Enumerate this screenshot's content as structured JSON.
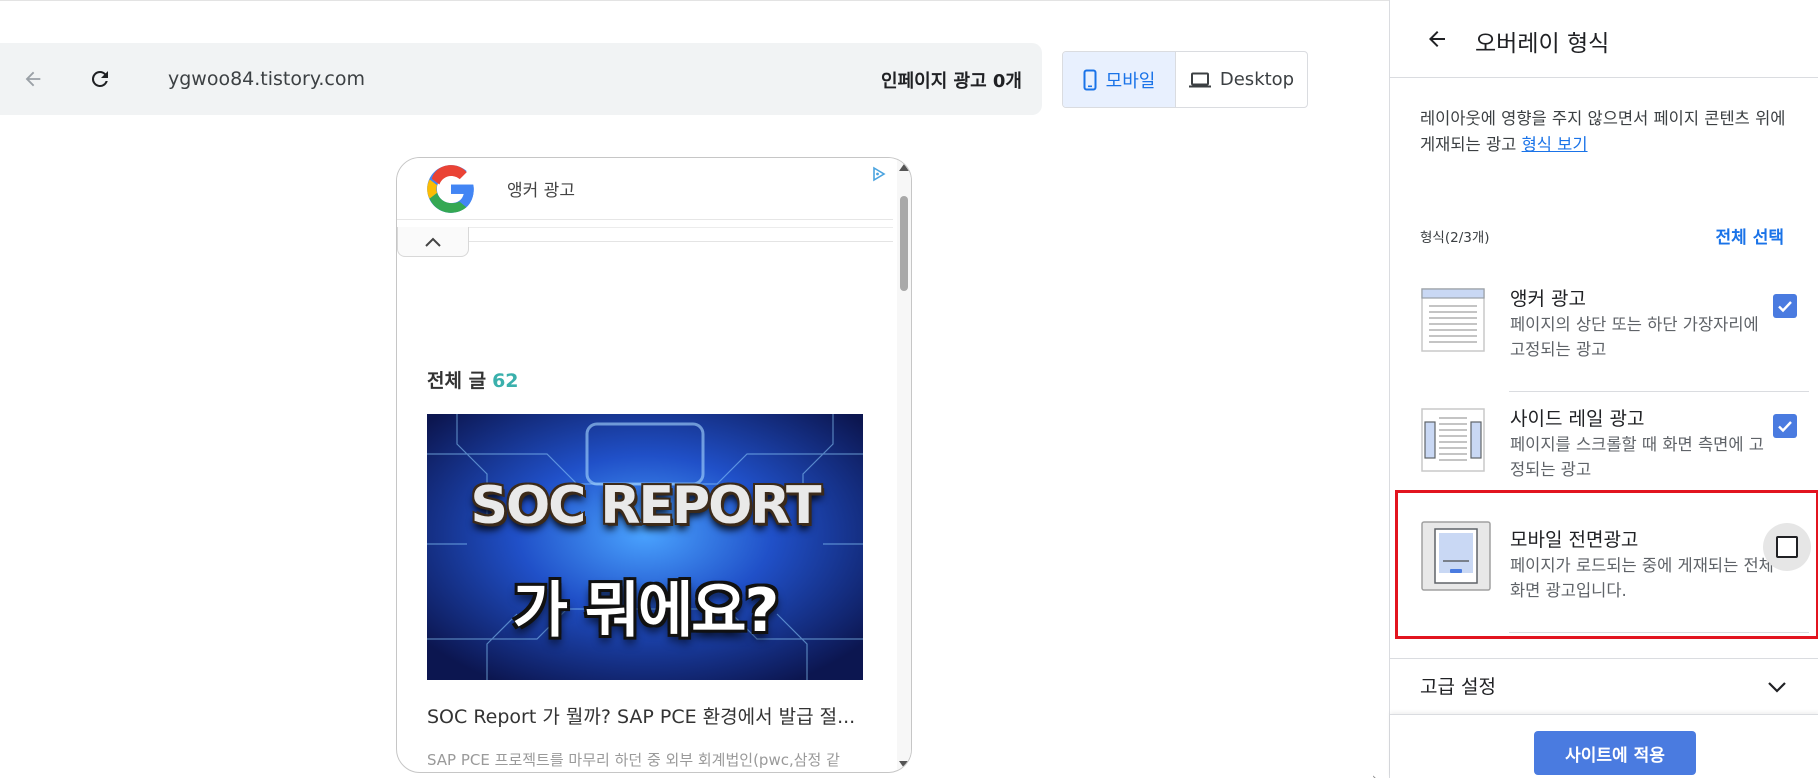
{
  "browser": {
    "url": "ygwoo84.tistory.com",
    "inpage_ads": "인페이지 광고 0개"
  },
  "device_toggle": {
    "mobile_label": "모바일",
    "desktop_label": "Desktop",
    "selected": "mobile"
  },
  "preview": {
    "anchor_ad_label": "앵커 광고",
    "post_heading": "전체 글",
    "post_count": "62",
    "thumbnail_line1": "SOC REPORT",
    "thumbnail_line2": "가 뭐에요?",
    "post_title": "SOC Report 가 뭘까? SAP PCE 환경에서 발급 절...",
    "post_excerpt": "SAP PCE 프로젝트를 마무리 하던 중 외부 회계법인(pwc,삼정 같"
  },
  "panel": {
    "title": "오버레이 형식",
    "description": "레이아웃에 영향을 주지 않으면서 페이지 콘텐츠 위에 게재되는 광고",
    "learn_link": "형식 보기",
    "format_count": "형식(2/3개)",
    "select_all": "전체 선택",
    "formats": [
      {
        "title": "앵커 광고",
        "desc": "페이지의 상단 또는 하단 가장자리에 고정되는 광고",
        "checked": true
      },
      {
        "title": "사이드 레일 광고",
        "desc": "페이지를 스크롤할 때 화면 측면에 고정되는 광고",
        "checked": true
      },
      {
        "title": "모바일 전면광고",
        "desc": "페이지가 로드되는 중에 게재되는 전체 화면 광고입니다.",
        "checked": false
      }
    ],
    "advanced": "고급 설정",
    "apply": "사이트에 적용"
  },
  "colors": {
    "accent": "#4a7be0",
    "link": "#1a73e8",
    "highlight": "#e2141f",
    "count": "#3ab0ac"
  }
}
